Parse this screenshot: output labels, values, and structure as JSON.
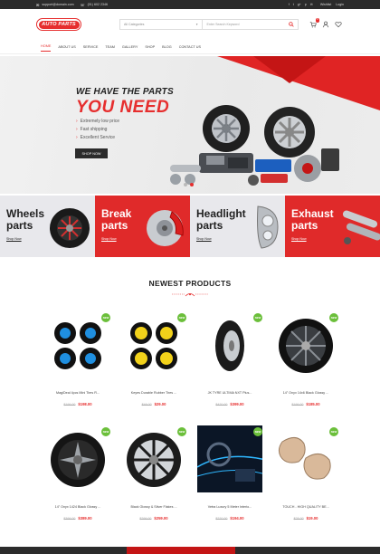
{
  "topbar": {
    "email": "support@domain.com",
    "phone": "(01) 602 2346",
    "social": [
      "f",
      "t",
      "g+",
      "p",
      "✉"
    ],
    "wishlist": "Wishlist",
    "login": "Login"
  },
  "header": {
    "logo_text": "AUTO PARTS",
    "search_category": "All Categories",
    "search_placeholder": "Enter Search Keyword",
    "cart_count": "0"
  },
  "nav": {
    "items": [
      "HOME",
      "ABOUT US",
      "SERVICE",
      "TEAM",
      "GALLERY",
      "SHOP",
      "BLOG",
      "CONTACT US"
    ]
  },
  "hero": {
    "line1": "WE HAVE THE PARTS",
    "line2": "YOU NEED",
    "bullets": [
      "Extremely low price",
      "Fast shipping",
      "Excellent Service"
    ],
    "button": "SHOP NOW"
  },
  "categories": [
    {
      "title1": "Wheels",
      "title2": "parts",
      "link": "Shop Now",
      "style": "light"
    },
    {
      "title1": "Break",
      "title2": "parts",
      "link": "Shop Now",
      "style": "red"
    },
    {
      "title1": "Headlight",
      "title2": "parts",
      "link": "Shop Now",
      "style": "light"
    },
    {
      "title1": "Exhaust",
      "title2": "parts",
      "link": "Shop Now",
      "style": "red"
    }
  ],
  "newest": {
    "heading": "NEWEST PRODUCTS",
    "badge": "NEW",
    "products": [
      {
        "name": "MagiDeal 4pcs Mini Tires R...",
        "old": "$199.00",
        "price": "$198.00",
        "icon": "blue-tire-set-icon"
      },
      {
        "name": "Keyes Durable Rubber Tires ...",
        "old": "$49.00",
        "price": "$29.00",
        "icon": "yellow-tire-set-icon"
      },
      {
        "name": "JK TYRE ULTIMA NXT Plus...",
        "old": "$420.00",
        "price": "$399.00",
        "icon": "tyre-icon"
      },
      {
        "name": "14\" Onyx 14x6 Black Glossy ...",
        "old": "$199.00",
        "price": "$185.00",
        "icon": "alloy-wheel-icon"
      },
      {
        "name": "14\" Onyx 1424 Black Glossy ...",
        "old": "$399.00",
        "price": "$389.00",
        "icon": "black-rim-icon"
      },
      {
        "name": "Black Glossy & Silver Flakes ...",
        "old": "$299.00",
        "price": "$259.00",
        "icon": "silver-rim-icon"
      },
      {
        "name": "Vetra Luxury 5 Meter Interio...",
        "old": "$220.00",
        "price": "$194.00",
        "icon": "car-interior-icon"
      },
      {
        "name": "TOUCH - HIGH QUALITY BE...",
        "old": "$25.00",
        "price": "$19.00",
        "icon": "neck-pillow-icon"
      }
    ]
  },
  "colors": {
    "accent": "#e62e2e",
    "dark": "#2b2b2b",
    "new_badge": "#6bbf3a"
  }
}
